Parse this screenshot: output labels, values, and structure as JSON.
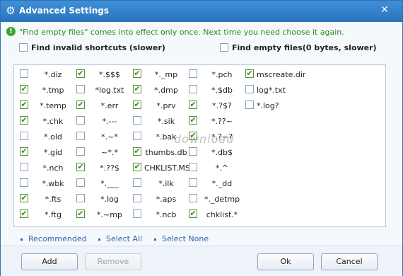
{
  "window": {
    "title": "Advanced Settings",
    "close": "✕"
  },
  "notice": "\"Find empty files\" comes into effect only once. Next time you need choose it again.",
  "options": {
    "invalid_shortcuts": {
      "label": "Find invalid shortcuts (slower)",
      "checked": false
    },
    "empty_files": {
      "label": "Find empty files(0 bytes, slower)",
      "checked": false
    }
  },
  "patterns": [
    [
      {
        "label": "*.diz",
        "checked": false
      },
      {
        "label": "*.$$$",
        "checked": true
      },
      {
        "label": "*._mp",
        "checked": true
      },
      {
        "label": "*.pch",
        "checked": false
      },
      {
        "label": "mscreate.dir",
        "checked": true
      }
    ],
    [
      {
        "label": "*.tmp",
        "checked": true
      },
      {
        "label": "*log.txt",
        "checked": false
      },
      {
        "label": "*.dmp",
        "checked": true
      },
      {
        "label": "*.$db",
        "checked": false
      },
      {
        "label": "log*.txt",
        "checked": false
      }
    ],
    [
      {
        "label": "*.temp",
        "checked": true
      },
      {
        "label": "*.err",
        "checked": true
      },
      {
        "label": "*.prv",
        "checked": true
      },
      {
        "label": "*.?$?",
        "checked": true
      },
      {
        "label": "*.log?",
        "checked": false
      }
    ],
    [
      {
        "label": "*.chk",
        "checked": true
      },
      {
        "label": "*.---",
        "checked": false
      },
      {
        "label": "*.sik",
        "checked": false
      },
      {
        "label": "*.??~",
        "checked": true
      }
    ],
    [
      {
        "label": "*.old",
        "checked": false
      },
      {
        "label": "*.~*",
        "checked": false
      },
      {
        "label": "*.bak",
        "checked": false
      },
      {
        "label": "*.?~?",
        "checked": true
      }
    ],
    [
      {
        "label": "*.gid",
        "checked": true
      },
      {
        "label": "~*.*",
        "checked": false
      },
      {
        "label": "thumbs.db",
        "checked": true
      },
      {
        "label": "*.db$",
        "checked": false
      }
    ],
    [
      {
        "label": "*.nch",
        "checked": false
      },
      {
        "label": "*.??$",
        "checked": true
      },
      {
        "label": "CHKLIST.MS",
        "checked": true
      },
      {
        "label": "*.^",
        "checked": false
      }
    ],
    [
      {
        "label": "*.wbk",
        "checked": false
      },
      {
        "label": "*.___",
        "checked": false
      },
      {
        "label": "*.ilk",
        "checked": false
      },
      {
        "label": "*._dd",
        "checked": false
      }
    ],
    [
      {
        "label": "*.fts",
        "checked": true
      },
      {
        "label": "*.log",
        "checked": false
      },
      {
        "label": "*.aps",
        "checked": false
      },
      {
        "label": "*._detmp",
        "checked": false
      }
    ],
    [
      {
        "label": "*.ftg",
        "checked": true
      },
      {
        "label": "*.~mp",
        "checked": true
      },
      {
        "label": "*.ncb",
        "checked": false
      },
      {
        "label": "chklist.*",
        "checked": true
      }
    ]
  ],
  "links": {
    "recommended": "Recommended",
    "select_all": "Select All",
    "select_none": "Select None"
  },
  "buttons": {
    "add": "Add",
    "remove": "Remove",
    "ok": "Ok",
    "cancel": "Cancel"
  },
  "watermark": "download",
  "colors": {
    "title_bar": "#2f7ec9",
    "notice": "#2b8a1f",
    "link": "#2a63b0"
  }
}
